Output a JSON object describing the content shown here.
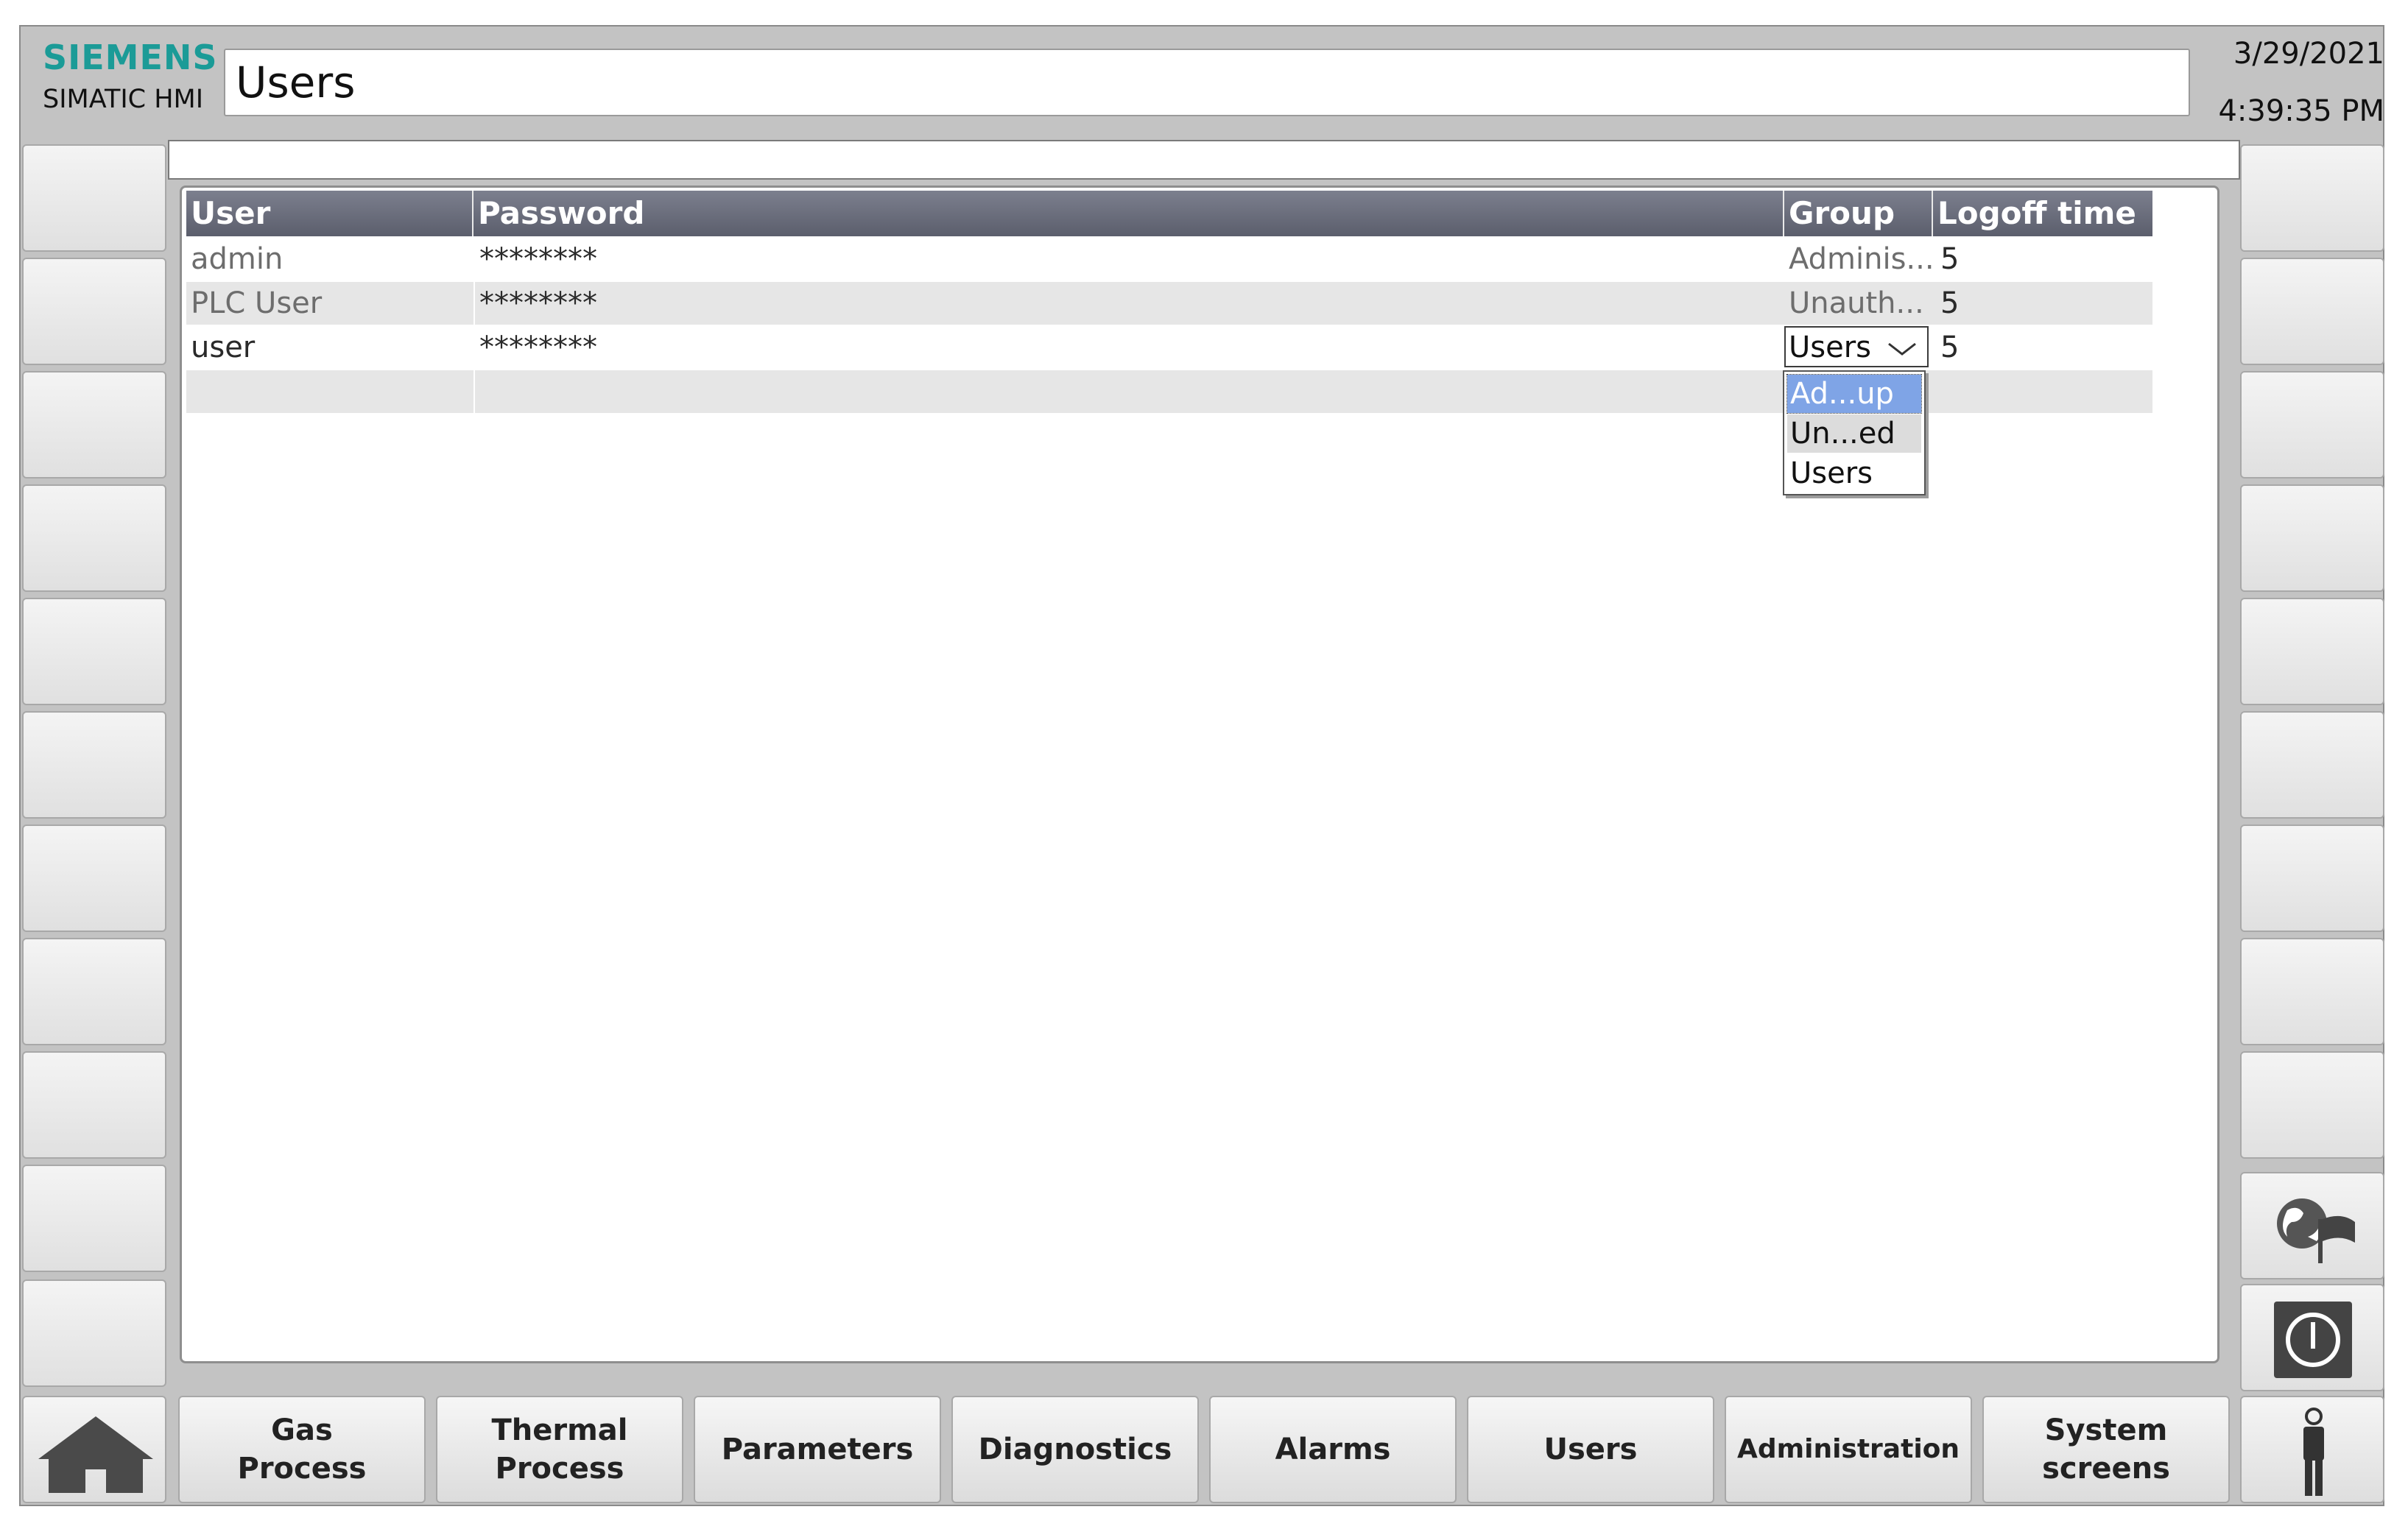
{
  "header": {
    "brand": "SIEMENS",
    "product": "SIMATIC HMI",
    "title": "Users",
    "date": "3/29/2021",
    "time": "4:39:35 PM"
  },
  "user_view": {
    "columns": [
      "User",
      "Password",
      "Group",
      "Logoff time"
    ],
    "rows": [
      {
        "user": "admin",
        "password": "********",
        "group": "Adminis...",
        "logoff": "5"
      },
      {
        "user": "PLC User",
        "password": "********",
        "group": "Unauth...",
        "logoff": "5"
      },
      {
        "user": "user",
        "password": "********",
        "group": "Users",
        "logoff": "5"
      }
    ],
    "group_dropdown": {
      "selected": "Users",
      "options": [
        "Ad...up",
        "Un...ed",
        "Users"
      ],
      "highlighted": "Ad...up"
    }
  },
  "nav": {
    "buttons": [
      "Gas\nProcess",
      "Thermal\nProcess",
      "Parameters",
      "Diagnostics",
      "Alarms",
      "Users",
      "Administration",
      "System\nscreens"
    ]
  },
  "icons": {
    "home": "home-icon",
    "language": "globe-flag-icon",
    "power": "power-icon",
    "user": "person-icon"
  },
  "colors": {
    "brand": "#1b9b97",
    "header_bar": "#6b6e7c",
    "selection": "#7fa4e6"
  }
}
